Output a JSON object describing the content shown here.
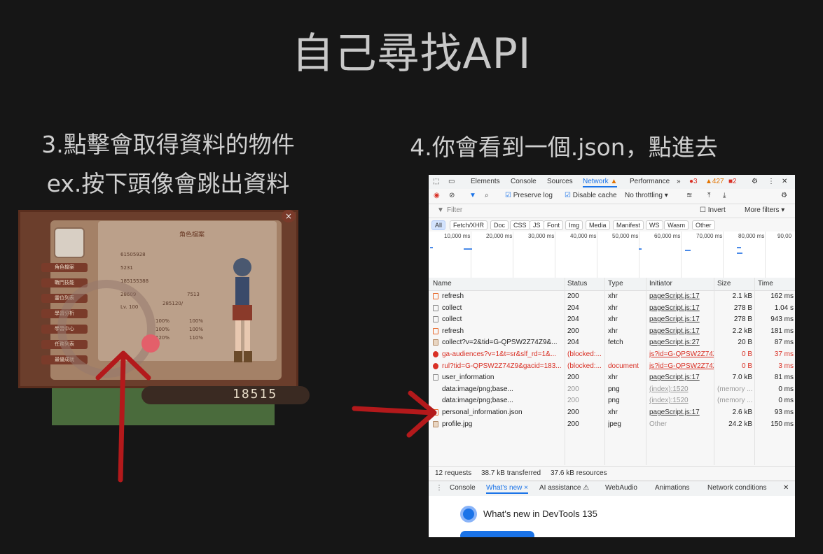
{
  "slide": {
    "title": "自己尋找API",
    "caption_left_1": "3.點擊會取得資料的物件",
    "caption_left_2": "ex.按下頭像會跳出資料",
    "caption_right": "4.你會看到一個.json，點進去"
  },
  "game": {
    "header_tag": "角色檔案",
    "menu_items": [
      "角色檔案",
      "戰鬥技能",
      "靈位列表",
      "學習分析",
      "學習中心",
      "任務列表",
      "最優成就"
    ],
    "stats": [
      "61505928",
      "5231",
      "185155388",
      "28609",
      "7513"
    ],
    "level_label": "Lv. 100",
    "hp_label": "285120/",
    "percents": [
      "100%",
      "100%",
      "100%",
      "120%",
      "110%",
      "100%"
    ],
    "bottom_number": "18515"
  },
  "devtools": {
    "tabs": [
      "Elements",
      "Console",
      "Sources",
      "Network",
      "Performance",
      "»"
    ],
    "issue_counts": {
      "errors": "3",
      "warnings": "427",
      "info": "2"
    },
    "toolbar": {
      "preserve_log": "Preserve log",
      "disable_cache": "Disable cache",
      "throttling": "No throttling"
    },
    "filter_placeholder": "Filter",
    "invert": "Invert",
    "more_filters": "More filters ▾",
    "type_chips": [
      "All",
      "Fetch/XHR",
      "Doc",
      "CSS",
      "JS",
      "Font",
      "Img",
      "Media",
      "Manifest",
      "WS",
      "Wasm",
      "Other"
    ],
    "timeline_labels": [
      "10,000 ms",
      "20,000 ms",
      "30,000 ms",
      "40,000 ms",
      "50,000 ms",
      "60,000 ms",
      "70,000 ms",
      "80,000 ms",
      "90,00"
    ],
    "columns": [
      "Name",
      "Status",
      "Type",
      "Initiator",
      "Size",
      "Time"
    ],
    "rows": [
      {
        "name": "refresh",
        "status": "200",
        "type": "xhr",
        "initiator": "pageScript.js:17",
        "size": "2.1 kB",
        "time": "162 ms",
        "icon": "xhr"
      },
      {
        "name": "collect",
        "status": "204",
        "type": "xhr",
        "initiator": "pageScript.js:17",
        "size": "278 B",
        "time": "1.04 s",
        "icon": "doc"
      },
      {
        "name": "collect",
        "status": "204",
        "type": "xhr",
        "initiator": "pageScript.js:17",
        "size": "278 B",
        "time": "943 ms",
        "icon": "doc"
      },
      {
        "name": "refresh",
        "status": "200",
        "type": "xhr",
        "initiator": "pageScript.js:17",
        "size": "2.2 kB",
        "time": "181 ms",
        "icon": "xhr"
      },
      {
        "name": "collect?v=2&tid=G-QPSW2Z74Z9&...",
        "status": "204",
        "type": "fetch",
        "initiator": "pageScript.js:27",
        "size": "20 B",
        "time": "87 ms",
        "icon": "img"
      },
      {
        "name": "ga-audiences?v=1&t=sr&slf_rd=1&...",
        "status": "(blocked:...",
        "type": "",
        "initiator": "js?id=G-QPSW2Z74Z",
        "size": "0 B",
        "time": "37 ms",
        "icon": "err"
      },
      {
        "name": "rul?tid=G-QPSW2Z74Z9&gacid=183...",
        "status": "(blocked:...",
        "type": "document",
        "initiator": "js?id=G-QPSW2Z74Z",
        "size": "0 B",
        "time": "3 ms",
        "icon": "err"
      },
      {
        "name": "user_information",
        "status": "200",
        "type": "xhr",
        "initiator": "pageScript.js:17",
        "size": "7.0 kB",
        "time": "81 ms",
        "icon": "doc"
      },
      {
        "name": "data:image/png;base...",
        "status": "200",
        "type": "png",
        "initiator": "(index):1520",
        "size": "(memory ...",
        "time": "0 ms",
        "icon": "none"
      },
      {
        "name": "data:image/png;base...",
        "status": "200",
        "type": "png",
        "initiator": "(index):1520",
        "size": "(memory ...",
        "time": "0 ms",
        "icon": "none"
      },
      {
        "name": "personal_information.json",
        "status": "200",
        "type": "xhr",
        "initiator": "pageScript.js:17",
        "size": "2.6 kB",
        "time": "93 ms",
        "icon": "xhr"
      },
      {
        "name": "profile.jpg",
        "status": "200",
        "type": "jpeg",
        "initiator": "Other",
        "size": "24.2 kB",
        "time": "150 ms",
        "icon": "img"
      }
    ],
    "status_bar": {
      "requests": "12 requests",
      "transferred": "38.7 kB transferred",
      "resources": "37.6 kB resources"
    },
    "drawer_tabs": [
      "Console",
      "What's new ×",
      "AI assistance ⚠",
      "WebAudio",
      "Animations",
      "Network conditions"
    ],
    "drawer_title": "What's new in DevTools 135"
  },
  "colors": {
    "background": "#161616",
    "arrow": "#b3191b",
    "devtools_accent": "#1a73e8"
  }
}
